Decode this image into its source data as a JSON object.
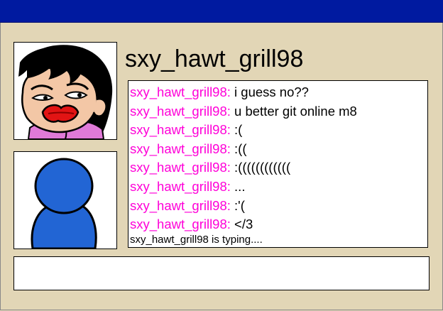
{
  "window": {
    "title_bar_color": "#001aa0",
    "background_color": "#e2d6b6"
  },
  "contact": {
    "username": "sxy_hawt_grill98",
    "avatar_icon": "cartoon-girl-avatar-icon"
  },
  "self": {
    "avatar_icon": "blue-silhouette-avatar-icon"
  },
  "chat": {
    "sender_color": "#ff00d8",
    "messages": [
      {
        "sender": "sxy_hawt_grill98:",
        "text": "i guess no??"
      },
      {
        "sender": "sxy_hawt_grill98:",
        "text": "u better git online m8"
      },
      {
        "sender": "sxy_hawt_grill98:",
        "text": ":("
      },
      {
        "sender": "sxy_hawt_grill98:",
        "text": ":(("
      },
      {
        "sender": "sxy_hawt_grill98:",
        "text": ":(((((((((((("
      },
      {
        "sender": "sxy_hawt_grill98:",
        "text": "..."
      },
      {
        "sender": "sxy_hawt_grill98:",
        "text": ":'("
      },
      {
        "sender": "sxy_hawt_grill98:",
        "text": "</3"
      }
    ],
    "typing_status": "sxy_hawt_grill98 is typing...."
  },
  "compose": {
    "value": ""
  }
}
